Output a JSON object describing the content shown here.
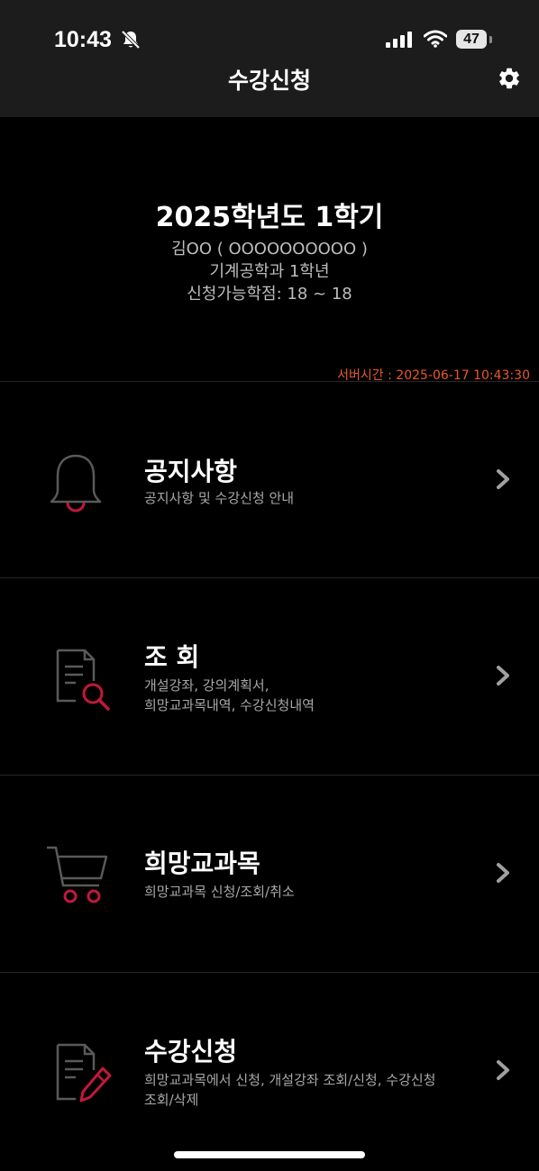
{
  "status_bar": {
    "time": "10:43",
    "battery": "47",
    "icons": [
      "bell-slash-icon",
      "cellular-signal-icon",
      "wifi-icon",
      "battery-icon"
    ]
  },
  "header": {
    "title": "수강신청",
    "settings_icon": "gear-icon"
  },
  "student": {
    "semester": "2025학년도 1학기",
    "name_id": "김OO ( OOOOOOOOOO )",
    "department": "기계공학과  1학년",
    "credits": "신청가능학점: 18 ~ 18"
  },
  "server_time": "서버시간 : 2025-06-17 10:43:30",
  "menu": [
    {
      "title": "공지사항",
      "desc": [
        "공지사항 및 수강신청 안내"
      ],
      "icon": "bell-icon"
    },
    {
      "title": "조    회",
      "desc": [
        "개설강좌, 강의계획서,",
        "희망교과목내역, 수강신청내역"
      ],
      "icon": "document-search-icon"
    },
    {
      "title": "희망교과목",
      "desc": [
        "희망교과목 신청/조회/취소"
      ],
      "icon": "shopping-cart-icon"
    },
    {
      "title": "수강신청",
      "desc": [
        "희망교과목에서 신청, 개설강좌 조회/신청, 수강신청",
        "조회/삭제"
      ],
      "icon": "document-edit-icon"
    }
  ],
  "colors": {
    "accent": "#c2183b",
    "server_time": "#e8592a",
    "header_bg": "#1c1c1c",
    "background": "#000000"
  }
}
